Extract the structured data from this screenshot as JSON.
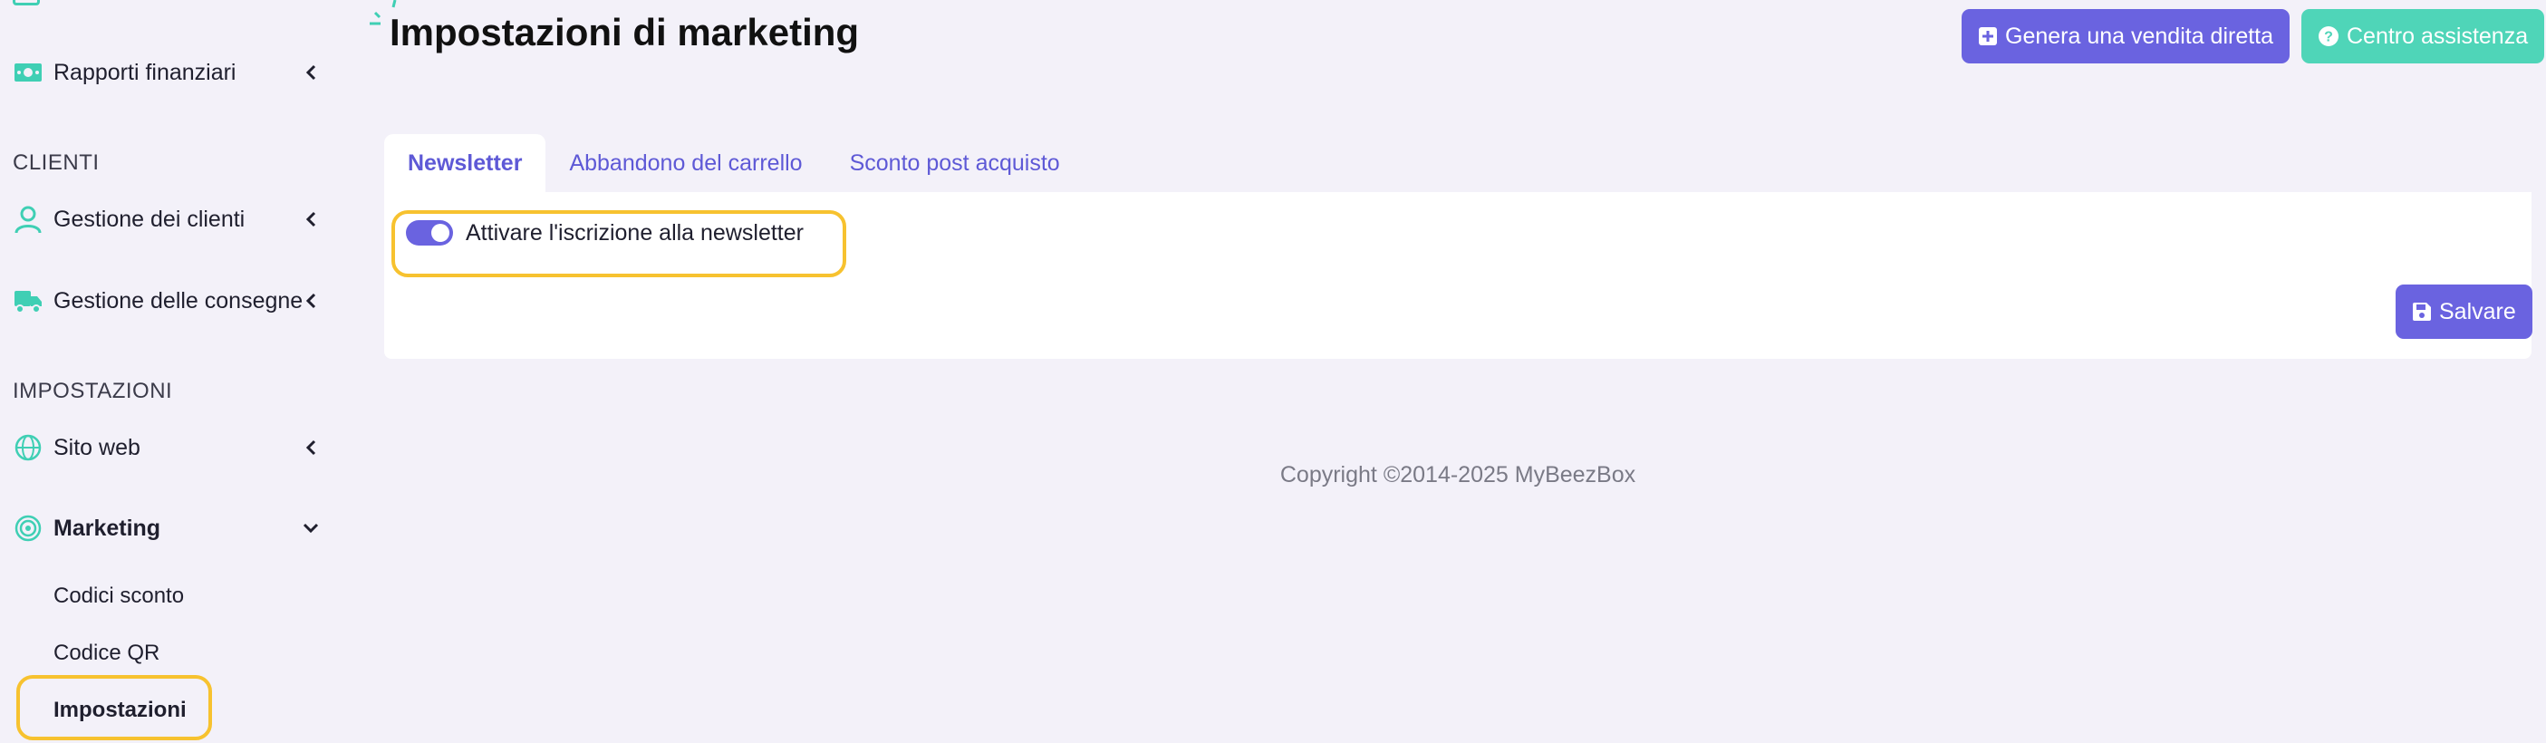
{
  "sidebar": {
    "sections": {
      "clients": "CLIENTI",
      "settings": "IMPOSTAZIONI"
    },
    "items": {
      "financial_reports": "Rapporti finanziari",
      "client_management": "Gestione dei clienti",
      "delivery_management": "Gestione delle consegne",
      "website": "Sito web",
      "marketing": "Marketing"
    },
    "marketing_sub": {
      "discount_codes": "Codici sconto",
      "qr_code": "Codice QR",
      "settings": "Impostazioni"
    },
    "icon_color": "#3fcfb4"
  },
  "header": {
    "title": "Impostazioni di marketing",
    "direct_sale_button": "Genera una vendita diretta",
    "help_center_button": "Centro assistenza"
  },
  "tabs": {
    "newsletter": "Newsletter",
    "cart_abandonment": "Abbandono del carrello",
    "post_purchase_discount": "Sconto post acquisto"
  },
  "panel": {
    "newsletter_toggle_label": "Attivare l'iscrizione alla newsletter",
    "newsletter_enabled": true,
    "save_button": "Salvare"
  },
  "footer": {
    "copyright": "Copyright ©2014-2025 MyBeezBox"
  },
  "colors": {
    "primary": "#6a63e0",
    "teal": "#4fd5b8",
    "highlight": "#f7c22f",
    "background": "#f3f1f9"
  }
}
